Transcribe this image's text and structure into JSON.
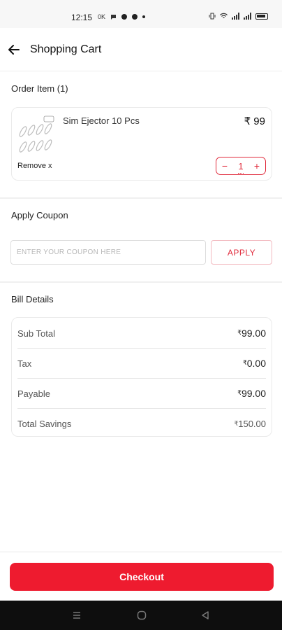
{
  "status_bar": {
    "time": "12:15",
    "carrier_badge": "0K"
  },
  "header": {
    "title": "Shopping Cart",
    "back_icon": "arrow-left-icon"
  },
  "order": {
    "section_title": "Order Item (1)",
    "item": {
      "name": "Sim Ejector 10 Pcs",
      "price": "₹ 99",
      "remove_label": "Remove x",
      "quantity": "1",
      "minus_label": "−",
      "plus_label": "+"
    }
  },
  "coupon": {
    "section_title": "Apply Coupon",
    "placeholder": "ENTER YOUR COUPON HERE",
    "value": "",
    "apply_label": "APPLY"
  },
  "bill": {
    "section_title": "Bill Details",
    "currency_symbol": "₹",
    "rows": [
      {
        "label": "Sub Total",
        "value": "99.00"
      },
      {
        "label": "Tax",
        "value": "0.00"
      },
      {
        "label": "Payable",
        "value": "99.00"
      },
      {
        "label": "Total Savings",
        "value": "150.00"
      }
    ]
  },
  "checkout": {
    "label": "Checkout"
  },
  "colors": {
    "accent": "#ee1b2f",
    "accent_text": "#e02b3c",
    "nav_bar": "#0e0e0e"
  },
  "nav": {
    "icons": [
      "menu-icon",
      "home-circle-icon",
      "back-triangle-icon"
    ]
  }
}
